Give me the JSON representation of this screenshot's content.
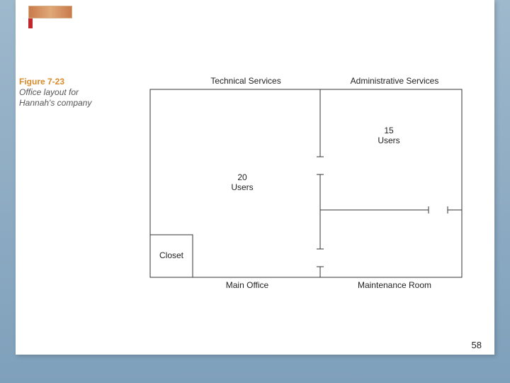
{
  "figure": {
    "number": "Figure 7-23",
    "title": "Office layout for Hannah's company"
  },
  "rooms": {
    "technical_services": "Technical Services",
    "administrative_services": "Administrative Services",
    "closet": "Closet",
    "main_office": "Main Office",
    "maintenance_room": "Maintenance Room"
  },
  "counts": {
    "tech_users_n": "20",
    "tech_users_w": "Users",
    "admin_users_n": "15",
    "admin_users_w": "Users"
  },
  "page_number": "58"
}
